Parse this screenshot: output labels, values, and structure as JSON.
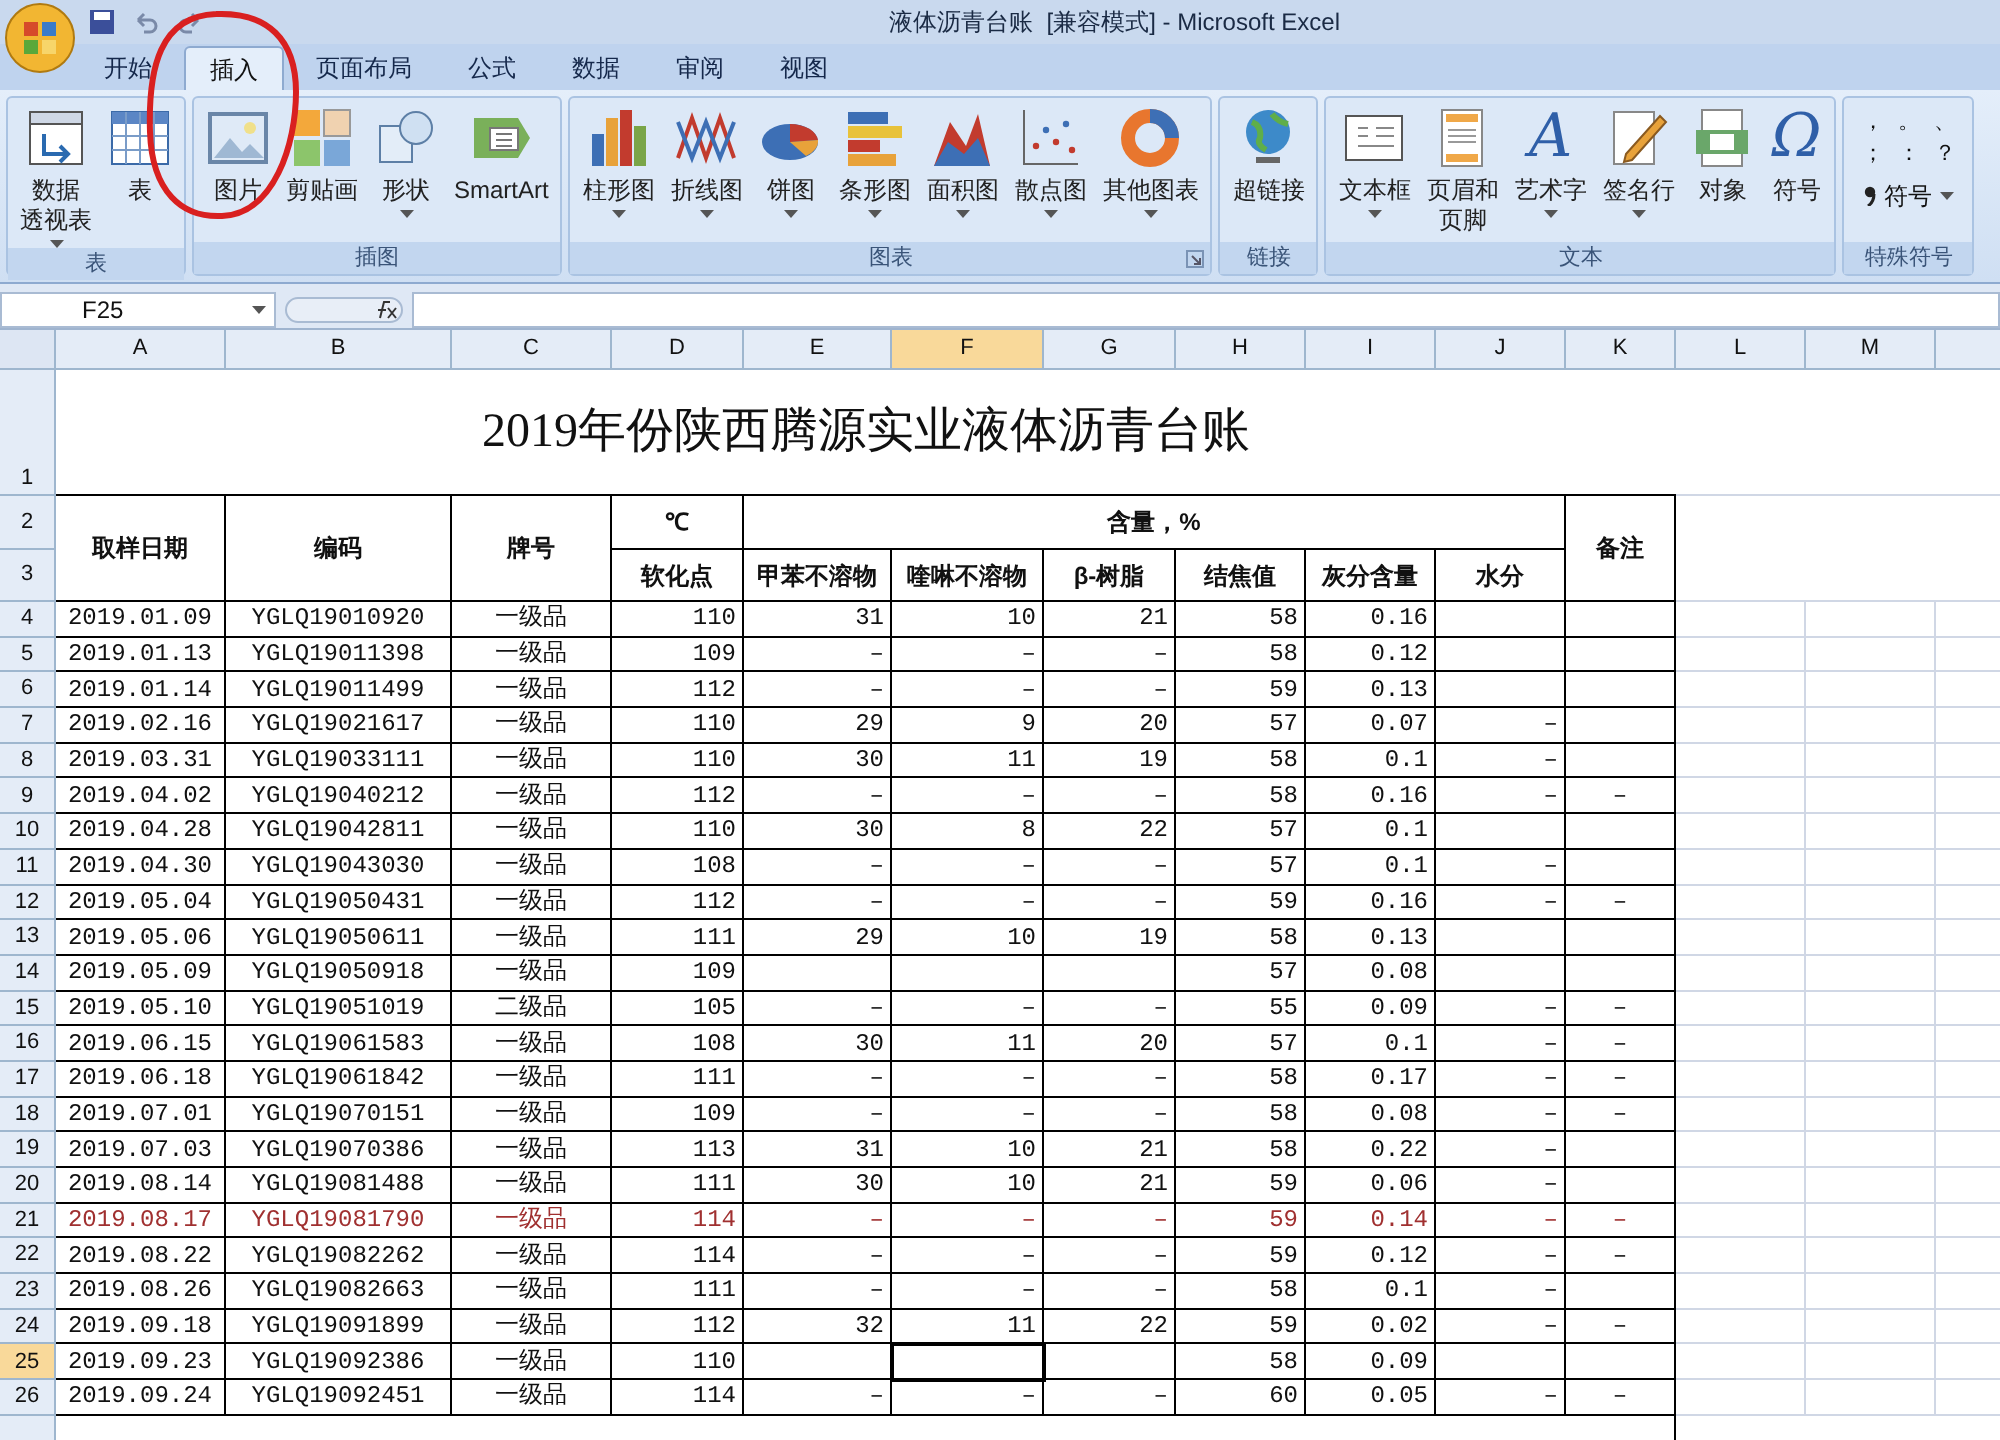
{
  "window": {
    "title": "液体沥青台账  [兼容模式] - Microsoft Excel"
  },
  "tabs": [
    {
      "label": "开始",
      "selected": false
    },
    {
      "label": "插入",
      "selected": true
    },
    {
      "label": "页面布局",
      "selected": false
    },
    {
      "label": "公式",
      "selected": false
    },
    {
      "label": "数据",
      "selected": false
    },
    {
      "label": "审阅",
      "selected": false
    },
    {
      "label": "视图",
      "selected": false
    }
  ],
  "ribbon_groups": [
    {
      "label": "表",
      "launcher": false,
      "buttons": [
        {
          "lines": [
            "数据",
            "透视表"
          ],
          "dropdown": true
        },
        {
          "lines": [
            "表"
          ],
          "dropdown": false
        }
      ]
    },
    {
      "label": "插图",
      "launcher": false,
      "buttons": [
        {
          "lines": [
            "图片"
          ],
          "dropdown": false
        },
        {
          "lines": [
            "剪贴画"
          ],
          "dropdown": false
        },
        {
          "lines": [
            "形状"
          ],
          "dropdown": true
        },
        {
          "lines": [
            "SmartArt"
          ],
          "dropdown": false
        }
      ]
    },
    {
      "label": "图表",
      "launcher": true,
      "buttons": [
        {
          "lines": [
            "柱形图"
          ],
          "dropdown": true
        },
        {
          "lines": [
            "折线图"
          ],
          "dropdown": true
        },
        {
          "lines": [
            "饼图"
          ],
          "dropdown": true
        },
        {
          "lines": [
            "条形图"
          ],
          "dropdown": true
        },
        {
          "lines": [
            "面积图"
          ],
          "dropdown": true
        },
        {
          "lines": [
            "散点图"
          ],
          "dropdown": true
        },
        {
          "lines": [
            "其他图表"
          ],
          "dropdown": true
        }
      ]
    },
    {
      "label": "链接",
      "launcher": false,
      "buttons": [
        {
          "lines": [
            "超链接"
          ],
          "dropdown": false
        }
      ]
    },
    {
      "label": "文本",
      "launcher": false,
      "buttons": [
        {
          "lines": [
            "文本框"
          ],
          "dropdown": true
        },
        {
          "lines": [
            "页眉和",
            "页脚"
          ],
          "dropdown": false
        },
        {
          "lines": [
            "艺术字"
          ],
          "dropdown": true,
          "glyph": "A"
        },
        {
          "lines": [
            "签名行"
          ],
          "dropdown": true
        },
        {
          "lines": [
            "对象"
          ],
          "dropdown": false
        },
        {
          "lines": [
            "符号"
          ],
          "dropdown": false,
          "glyph": "Ω"
        }
      ]
    }
  ],
  "special_symbols": {
    "label": "特殊符号",
    "symbols": [
      "，",
      "。",
      "、",
      "；",
      "：",
      "？"
    ],
    "button": "符号"
  },
  "name_box": "F25",
  "columns": [
    {
      "label": "A",
      "selected": false
    },
    {
      "label": "B",
      "selected": false
    },
    {
      "label": "C",
      "selected": false
    },
    {
      "label": "D",
      "selected": false
    },
    {
      "label": "E",
      "selected": false
    },
    {
      "label": "F",
      "selected": true
    },
    {
      "label": "G",
      "selected": false
    },
    {
      "label": "H",
      "selected": false
    },
    {
      "label": "I",
      "selected": false
    },
    {
      "label": "J",
      "selected": false
    },
    {
      "label": "K",
      "selected": false
    },
    {
      "label": "L",
      "selected": false
    },
    {
      "label": "M",
      "selected": false
    }
  ],
  "sheet_title": {
    "row": "1",
    "text": "2019年份陕西腾源实业液体沥青台账"
  },
  "header": {
    "rows": [
      "2",
      "3"
    ],
    "date": "取样日期",
    "code": "编码",
    "grade": "牌号",
    "unit": "℃",
    "softening": "软化点",
    "content": "含量，%",
    "sub": [
      "甲苯不溶物",
      "喹啉不溶物",
      "β-树脂",
      "结焦值",
      "灰分含量",
      "水分"
    ],
    "remarks": "备注"
  },
  "rows": [
    {
      "number": "4",
      "selected": false,
      "flagged": false,
      "cells": [
        "2019.01.09",
        "YGLQ19010920",
        "一级品",
        "110",
        "31",
        "10",
        "21",
        "58",
        "0.16",
        null,
        null
      ]
    },
    {
      "number": "5",
      "selected": false,
      "flagged": false,
      "cells": [
        "2019.01.13",
        "YGLQ19011398",
        "一级品",
        "109",
        "–",
        "–",
        "–",
        "58",
        "0.12",
        null,
        null
      ]
    },
    {
      "number": "6",
      "selected": false,
      "flagged": false,
      "cells": [
        "2019.01.14",
        "YGLQ19011499",
        "一级品",
        "112",
        "–",
        "–",
        "–",
        "59",
        "0.13",
        null,
        null
      ]
    },
    {
      "number": "7",
      "selected": false,
      "flagged": false,
      "cells": [
        "2019.02.16",
        "YGLQ19021617",
        "一级品",
        "110",
        "29",
        "9",
        "20",
        "57",
        "0.07",
        "–",
        null
      ]
    },
    {
      "number": "8",
      "selected": false,
      "flagged": false,
      "cells": [
        "2019.03.31",
        "YGLQ19033111",
        "一级品",
        "110",
        "30",
        "11",
        "19",
        "58",
        "0.1",
        "–",
        null
      ]
    },
    {
      "number": "9",
      "selected": false,
      "flagged": false,
      "cells": [
        "2019.04.02",
        "YGLQ19040212",
        "一级品",
        "112",
        "–",
        "–",
        "–",
        "58",
        "0.16",
        "–",
        "–"
      ]
    },
    {
      "number": "10",
      "selected": false,
      "flagged": false,
      "cells": [
        "2019.04.28",
        "YGLQ19042811",
        "一级品",
        "110",
        "30",
        "8",
        "22",
        "57",
        "0.1",
        null,
        null
      ]
    },
    {
      "number": "11",
      "selected": false,
      "flagged": false,
      "cells": [
        "2019.04.30",
        "YGLQ19043030",
        "一级品",
        "108",
        "–",
        "–",
        "–",
        "57",
        "0.1",
        "–",
        null
      ]
    },
    {
      "number": "12",
      "selected": false,
      "flagged": false,
      "cells": [
        "2019.05.04",
        "YGLQ19050431",
        "一级品",
        "112",
        "–",
        "–",
        "–",
        "59",
        "0.16",
        "–",
        "–"
      ]
    },
    {
      "number": "13",
      "selected": false,
      "flagged": false,
      "cells": [
        "2019.05.06",
        "YGLQ19050611",
        "一级品",
        "111",
        "29",
        "10",
        "19",
        "58",
        "0.13",
        null,
        null
      ]
    },
    {
      "number": "14",
      "selected": false,
      "flagged": false,
      "cells": [
        "2019.05.09",
        "YGLQ19050918",
        "一级品",
        "109",
        null,
        null,
        null,
        "57",
        "0.08",
        null,
        null
      ]
    },
    {
      "number": "15",
      "selected": false,
      "flagged": false,
      "cells": [
        "2019.05.10",
        "YGLQ19051019",
        "二级品",
        "105",
        "–",
        "–",
        "–",
        "55",
        "0.09",
        "–",
        "–"
      ]
    },
    {
      "number": "16",
      "selected": false,
      "flagged": false,
      "cells": [
        "2019.06.15",
        "YGLQ19061583",
        "一级品",
        "108",
        "30",
        "11",
        "20",
        "57",
        "0.1",
        "–",
        "–"
      ]
    },
    {
      "number": "17",
      "selected": false,
      "flagged": false,
      "cells": [
        "2019.06.18",
        "YGLQ19061842",
        "一级品",
        "111",
        "–",
        "–",
        "–",
        "58",
        "0.17",
        "–",
        "–"
      ]
    },
    {
      "number": "18",
      "selected": false,
      "flagged": false,
      "cells": [
        "2019.07.01",
        "YGLQ19070151",
        "一级品",
        "109",
        "–",
        "–",
        "–",
        "58",
        "0.08",
        "–",
        "–"
      ]
    },
    {
      "number": "19",
      "selected": false,
      "flagged": false,
      "cells": [
        "2019.07.03",
        "YGLQ19070386",
        "一级品",
        "113",
        "31",
        "10",
        "21",
        "58",
        "0.22",
        "–",
        null
      ]
    },
    {
      "number": "20",
      "selected": false,
      "flagged": false,
      "cells": [
        "2019.08.14",
        "YGLQ19081488",
        "一级品",
        "111",
        "30",
        "10",
        "21",
        "59",
        "0.06",
        "–",
        null
      ]
    },
    {
      "number": "21",
      "selected": false,
      "flagged": true,
      "cells": [
        "2019.08.17",
        "YGLQ19081790",
        "一级品",
        "114",
        "–",
        "–",
        "–",
        "59",
        "0.14",
        "–",
        "–"
      ]
    },
    {
      "number": "22",
      "selected": false,
      "flagged": false,
      "cells": [
        "2019.08.22",
        "YGLQ19082262",
        "一级品",
        "114",
        "–",
        "–",
        "–",
        "59",
        "0.12",
        "–",
        "–"
      ]
    },
    {
      "number": "23",
      "selected": false,
      "flagged": false,
      "cells": [
        "2019.08.26",
        "YGLQ19082663",
        "一级品",
        "111",
        "–",
        "–",
        "–",
        "58",
        "0.1",
        "–",
        null
      ]
    },
    {
      "number": "24",
      "selected": false,
      "flagged": false,
      "cells": [
        "2019.09.18",
        "YGLQ19091899",
        "一级品",
        "112",
        "32",
        "11",
        "22",
        "59",
        "0.02",
        "–",
        "–"
      ]
    },
    {
      "number": "25",
      "selected": true,
      "flagged": false,
      "cells": [
        "2019.09.23",
        "YGLQ19092386",
        "一级品",
        "110",
        null,
        null,
        null,
        "58",
        "0.09",
        null,
        null
      ]
    },
    {
      "number": "26",
      "selected": false,
      "flagged": false,
      "cells": [
        "2019.09.24",
        "YGLQ19092451",
        "一级品",
        "114",
        "–",
        "–",
        "–",
        "60",
        "0.05",
        "–",
        "–"
      ]
    }
  ]
}
